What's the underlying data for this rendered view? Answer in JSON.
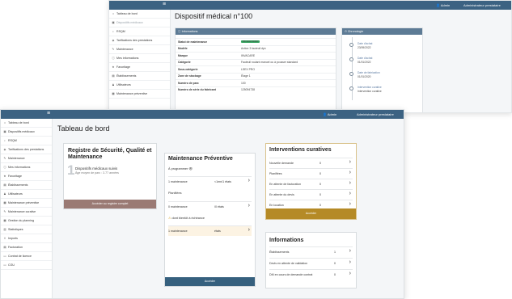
{
  "back": {
    "topbar": {
      "user": "Admin",
      "entity": "Administrateur prestataire"
    },
    "sidebar": [
      {
        "label": "Tableau de bord",
        "icon": "home-icon"
      },
      {
        "label": "Dispositifs médicaux",
        "icon": "device-icon"
      },
      {
        "label": "RSQM",
        "icon": "search-icon"
      },
      {
        "label": "Tarifications des prestations",
        "icon": "tag-icon"
      },
      {
        "label": "Maintenance",
        "icon": "wrench-icon"
      },
      {
        "label": "Mes informations",
        "icon": "info-icon"
      },
      {
        "label": "Favoritage",
        "icon": "star-icon"
      },
      {
        "label": "Établissements",
        "icon": "building-icon"
      },
      {
        "label": "Utilisateurs",
        "icon": "users-icon"
      },
      {
        "label": "Maintenance préventive",
        "icon": "calendar-icon"
      }
    ],
    "title": "Dispositif médical n°100",
    "info": {
      "header": "Informations",
      "rows": [
        {
          "k": "Statut de maintenance",
          "v": "OK sous contrat",
          "chip": true
        },
        {
          "k": "Modèle",
          "v": "Action 3 fauteuil dyn"
        },
        {
          "k": "Marque",
          "v": "INVACARE"
        },
        {
          "k": "Catégorie",
          "v": "Fauteuil roulant manuel ou à pousser standard"
        },
        {
          "k": "Sous-catégorie",
          "v": "LSEX PRO"
        },
        {
          "k": "Zone de stockage",
          "v": "Étage 1"
        },
        {
          "k": "Numéro de parc",
          "v": "100"
        },
        {
          "k": "Numéro de série du fabricant",
          "v": "125094738"
        }
      ]
    },
    "chrono": {
      "header": "Chronologie",
      "items": [
        {
          "t": "Date d'achat",
          "d": "23/09/2022"
        },
        {
          "t": "Date d'achat",
          "d": "01/01/2022"
        },
        {
          "t": "Date de fabrication",
          "d": "01/01/2020"
        },
        {
          "t": "Intervention curative",
          "d": "Intervention curative"
        }
      ]
    }
  },
  "front": {
    "topbar": {
      "user": "Admin",
      "entity": "Administrateur prestataire"
    },
    "sidebar": [
      {
        "label": "Tableau de bord",
        "icon": "home-icon"
      },
      {
        "label": "Dispositifs médicaux",
        "icon": "device-icon"
      },
      {
        "label": "RSQM",
        "icon": "search-icon"
      },
      {
        "label": "Tarifications des prestations",
        "icon": "tag-icon"
      },
      {
        "label": "Maintenance",
        "icon": "wrench-icon"
      },
      {
        "label": "Mes informations",
        "icon": "info-icon"
      },
      {
        "label": "Favoritage",
        "icon": "star-icon"
      },
      {
        "label": "Établissements",
        "icon": "building-icon"
      },
      {
        "label": "Utilisateurs",
        "icon": "users-icon"
      },
      {
        "label": "Maintenance préventive",
        "icon": "calendar-icon"
      },
      {
        "label": "Maintenance curative",
        "icon": "tools-icon"
      },
      {
        "label": "Gestion du planning",
        "icon": "calendar-icon"
      },
      {
        "label": "Statistiques",
        "icon": "chart-icon"
      },
      {
        "label": "Imports",
        "icon": "upload-icon"
      },
      {
        "label": "Facturation",
        "icon": "invoice-icon"
      },
      {
        "label": "Contrat de licence",
        "icon": "document-icon"
      },
      {
        "label": "CGU",
        "icon": "document-icon"
      }
    ],
    "title": "Tableau de bord",
    "registre": {
      "title": "Registre de Sécurité, Qualité et Maintenance",
      "count": "1",
      "line1": "Dispositifs médicaux suivis",
      "line2": "Âge moyen de parc : 3.77 années",
      "button": "Accéder au registre complet",
      "color": "#9a7a74"
    },
    "preventive": {
      "title": "Maintenance Préventive",
      "a_programmer": "À programmer",
      "row1": {
        "label": "1 maintenance",
        "count": "<1mn/1 états"
      },
      "planifiees": "Planifiées",
      "row2": {
        "label": "0 maintenance",
        "count": "/0 états"
      },
      "echeance": "dont bientôt à échéance",
      "row3": {
        "label": "1 maintenance",
        "count": "états"
      },
      "button": "Accéder",
      "color": "#36607e"
    },
    "curatives": {
      "title": "Interventions curatives",
      "rows": [
        {
          "label": "Nouvelle demande",
          "count": "0"
        },
        {
          "label": "Planifiées",
          "count": "0"
        },
        {
          "label": "En attente de facturation",
          "count": "0"
        },
        {
          "label": "En attente du devis",
          "count": "0"
        },
        {
          "label": "En location",
          "count": "0"
        }
      ],
      "button": "Accéder",
      "color": "#b58a26"
    },
    "infos": {
      "title": "Informations",
      "rows": [
        {
          "label": "Établissements",
          "count": "1"
        },
        {
          "label": "Devis en attente de validation",
          "count": "0"
        },
        {
          "label": "DM en cours de demande contrat",
          "count": "0"
        }
      ]
    }
  }
}
